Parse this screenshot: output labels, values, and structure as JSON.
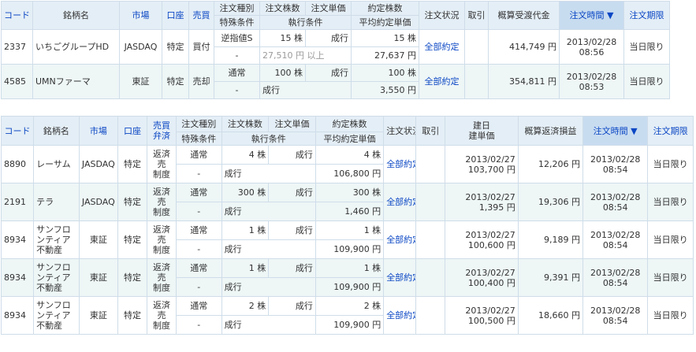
{
  "top_table": {
    "headers": {
      "code": "コード",
      "name": "銘柄名",
      "market": "市場",
      "account": "口座",
      "side": "売買",
      "order_type": "注文種別",
      "special": "特殊条件",
      "qty": "注文株数",
      "price": "注文単価",
      "exec_cond": "執行条件",
      "filled": "約定株数",
      "avg_price": "平均約定単価",
      "status": "注文状況",
      "cancel": "取引",
      "amount": "概算受渡代金",
      "time": "注文時間 ▼",
      "expiry": "注文期限"
    },
    "rows": [
      {
        "code": "2337",
        "name": "いちごグループHD",
        "market": "JASDAQ",
        "account": "特定",
        "side": "買付",
        "order_type": "逆指値S",
        "qty": "15 株",
        "price": "成行",
        "filled": "15 株",
        "special": "-",
        "exec_cond": "27,510 円 以上",
        "avg_price": "27,637 円",
        "status": "全部約定",
        "amount": "414,749 円",
        "date": "2013/02/28",
        "clock": "08:56",
        "expiry": "当日限り"
      },
      {
        "code": "4585",
        "name": "UMNファーマ",
        "market": "東証",
        "account": "特定",
        "side": "売却",
        "order_type": "通常",
        "qty": "100 株",
        "price": "成行",
        "filled": "100 株",
        "special": "-",
        "exec_cond": "成行",
        "avg_price": "3,550 円",
        "status": "全部約定",
        "amount": "354,811 円",
        "date": "2013/02/28",
        "clock": "08:53",
        "expiry": "当日限り"
      }
    ]
  },
  "bottom_table": {
    "headers": {
      "code": "コード",
      "name": "銘柄名",
      "market": "市場",
      "account": "口座",
      "side1": "売買",
      "side2": "弁済",
      "order_type": "注文種別",
      "special": "特殊条件",
      "qty": "注文株数",
      "price": "注文単価",
      "exec_cond": "執行条件",
      "filled": "約定株数",
      "avg_price": "平均約定単価",
      "status": "注文状況",
      "cancel": "取引",
      "open1": "建日",
      "open2": "建単価",
      "pl": "概算返済損益",
      "time": "注文時間 ▼",
      "expiry": "注文期限"
    },
    "rows": [
      {
        "code": "8890",
        "name": "レーサム",
        "market": "JASDAQ",
        "account": "特定",
        "side": [
          "返済",
          "売",
          "制度"
        ],
        "order_type": "通常",
        "qty": "4 株",
        "price": "成行",
        "filled": "4 株",
        "special": "-",
        "exec_cond": "成行",
        "avg_price": "106,800 円",
        "status": "全部約定",
        "open_date": "2013/02/27",
        "open_price": "103,700 円",
        "pl": "12,206 円",
        "date": "2013/02/28",
        "clock": "08:54",
        "expiry": "当日限り"
      },
      {
        "code": "2191",
        "name": "テラ",
        "market": "JASDAQ",
        "account": "特定",
        "side": [
          "返済",
          "売",
          "制度"
        ],
        "order_type": "通常",
        "qty": "300 株",
        "price": "成行",
        "filled": "300 株",
        "special": "-",
        "exec_cond": "成行",
        "avg_price": "1,460 円",
        "status": "全部約定",
        "open_date": "2013/02/27",
        "open_price": "1,395 円",
        "pl": "19,306 円",
        "date": "2013/02/28",
        "clock": "08:54",
        "expiry": "当日限り"
      },
      {
        "code": "8934",
        "name": [
          "サンフロ",
          "ンティア",
          "不動産"
        ],
        "market": "東証",
        "account": "特定",
        "side": [
          "返済",
          "売",
          "制度"
        ],
        "order_type": "通常",
        "qty": "1 株",
        "price": "成行",
        "filled": "1 株",
        "special": "-",
        "exec_cond": "成行",
        "avg_price": "109,900 円",
        "status": "全部約定",
        "open_date": "2013/02/27",
        "open_price": "100,600 円",
        "pl": "9,189 円",
        "date": "2013/02/28",
        "clock": "08:54",
        "expiry": "当日限り"
      },
      {
        "code": "8934",
        "name": [
          "サンフロ",
          "ンティア",
          "不動産"
        ],
        "market": "東証",
        "account": "特定",
        "side": [
          "返済",
          "売",
          "制度"
        ],
        "order_type": "通常",
        "qty": "1 株",
        "price": "成行",
        "filled": "1 株",
        "special": "-",
        "exec_cond": "成行",
        "avg_price": "109,900 円",
        "status": "全部約定",
        "open_date": "2013/02/27",
        "open_price": "100,400 円",
        "pl": "9,391 円",
        "date": "2013/02/28",
        "clock": "08:54",
        "expiry": "当日限り"
      },
      {
        "code": "8934",
        "name": [
          "サンフロ",
          "ンティア",
          "不動産"
        ],
        "market": "東証",
        "account": "特定",
        "side": [
          "返済",
          "売",
          "制度"
        ],
        "order_type": "通常",
        "qty": "2 株",
        "price": "成行",
        "filled": "2 株",
        "special": "-",
        "exec_cond": "成行",
        "avg_price": "109,900 円",
        "status": "全部約定",
        "open_date": "2013/02/27",
        "open_price": "100,500 円",
        "pl": "18,660 円",
        "date": "2013/02/28",
        "clock": "08:54",
        "expiry": "当日限り"
      }
    ]
  }
}
